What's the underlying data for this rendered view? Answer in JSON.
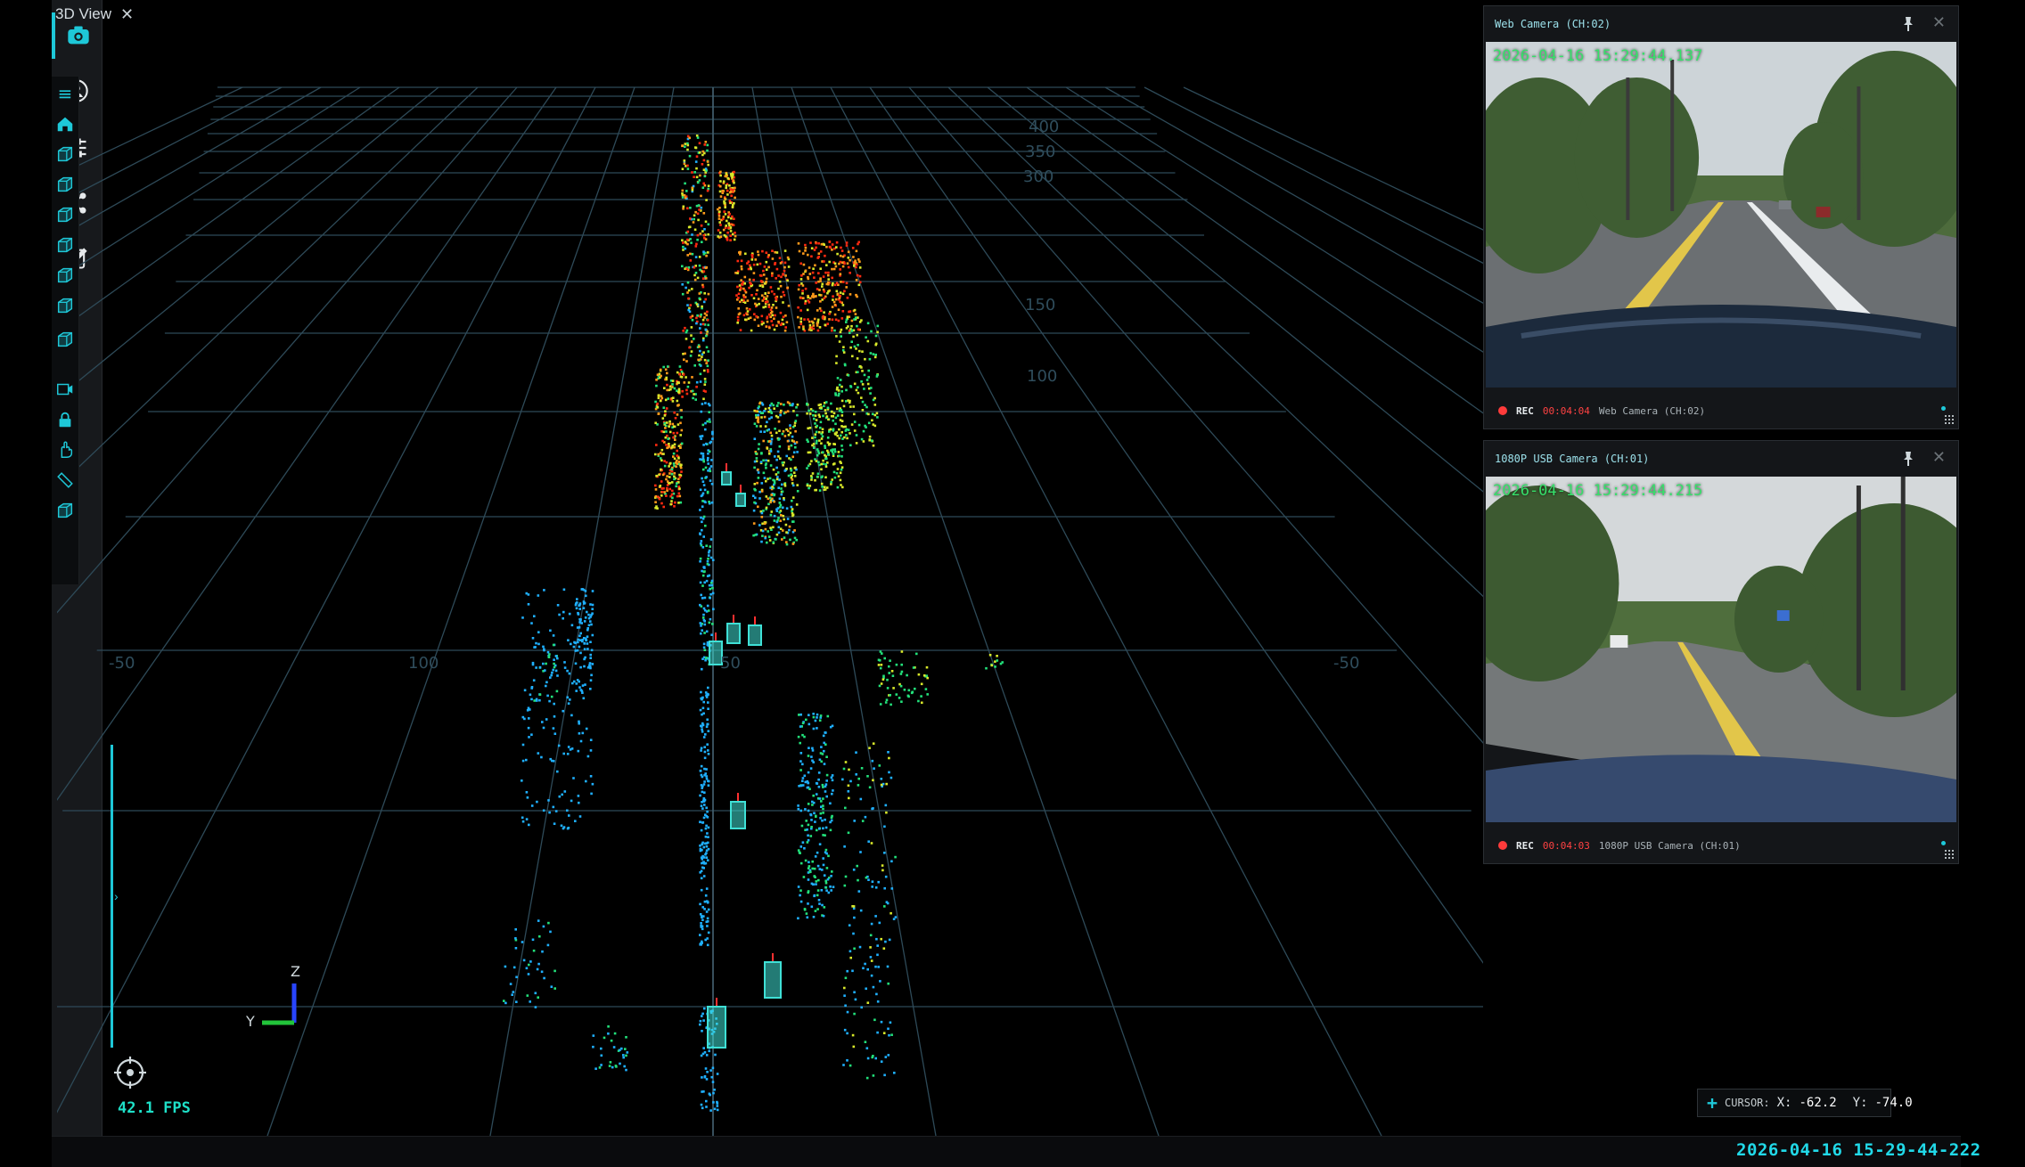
{
  "tab": {
    "label": "3D View",
    "close": "✕"
  },
  "rail": {
    "items": [
      {
        "name": "camera",
        "active": true
      },
      {
        "name": "user",
        "active": false
      },
      {
        "name": "sliders",
        "active": false
      },
      {
        "name": "share",
        "active": false
      },
      {
        "name": "edit",
        "active": false
      }
    ]
  },
  "tools": {
    "menu": "≡",
    "items": [
      "home",
      "view-front",
      "view-side",
      "view-left",
      "view-right",
      "view-top",
      "view-bottom",
      "view-iso",
      "capture",
      "lock",
      "pan",
      "measure",
      "box"
    ]
  },
  "grid": {
    "labels_y": [
      "400",
      "350",
      "300",
      "150",
      "100"
    ],
    "labels_x": [
      "-50",
      "100",
      "50",
      "-50"
    ]
  },
  "cam1": {
    "title": "Web  Camera (CH:02)",
    "timestamp": "2026-04-16 15:29:44.137",
    "rec_label": "REC",
    "rec_time": "00:04:04",
    "footer_name": "Web  Camera (CH:02)"
  },
  "cam2": {
    "title": "1080P USB Camera (CH:01)",
    "timestamp": "2026-04-16 15:29:44.215",
    "rec_label": "REC",
    "rec_time": "00:04:03",
    "footer_name": "1080P USB Camera (CH:01)"
  },
  "axis": {
    "z": "Z",
    "y": "Y"
  },
  "fps": "42.1 FPS",
  "cursor": {
    "label": "CURSOR:",
    "x_label": "X:",
    "x_value": "-62.2",
    "y_label": "Y:",
    "y_value": "-74.0"
  },
  "footer_timestamp": "2026-04-16 15-29-44-222",
  "colors": {
    "accent": "#1ec8d8",
    "grid": "#2e4a58",
    "box": "#3fe0d6"
  }
}
